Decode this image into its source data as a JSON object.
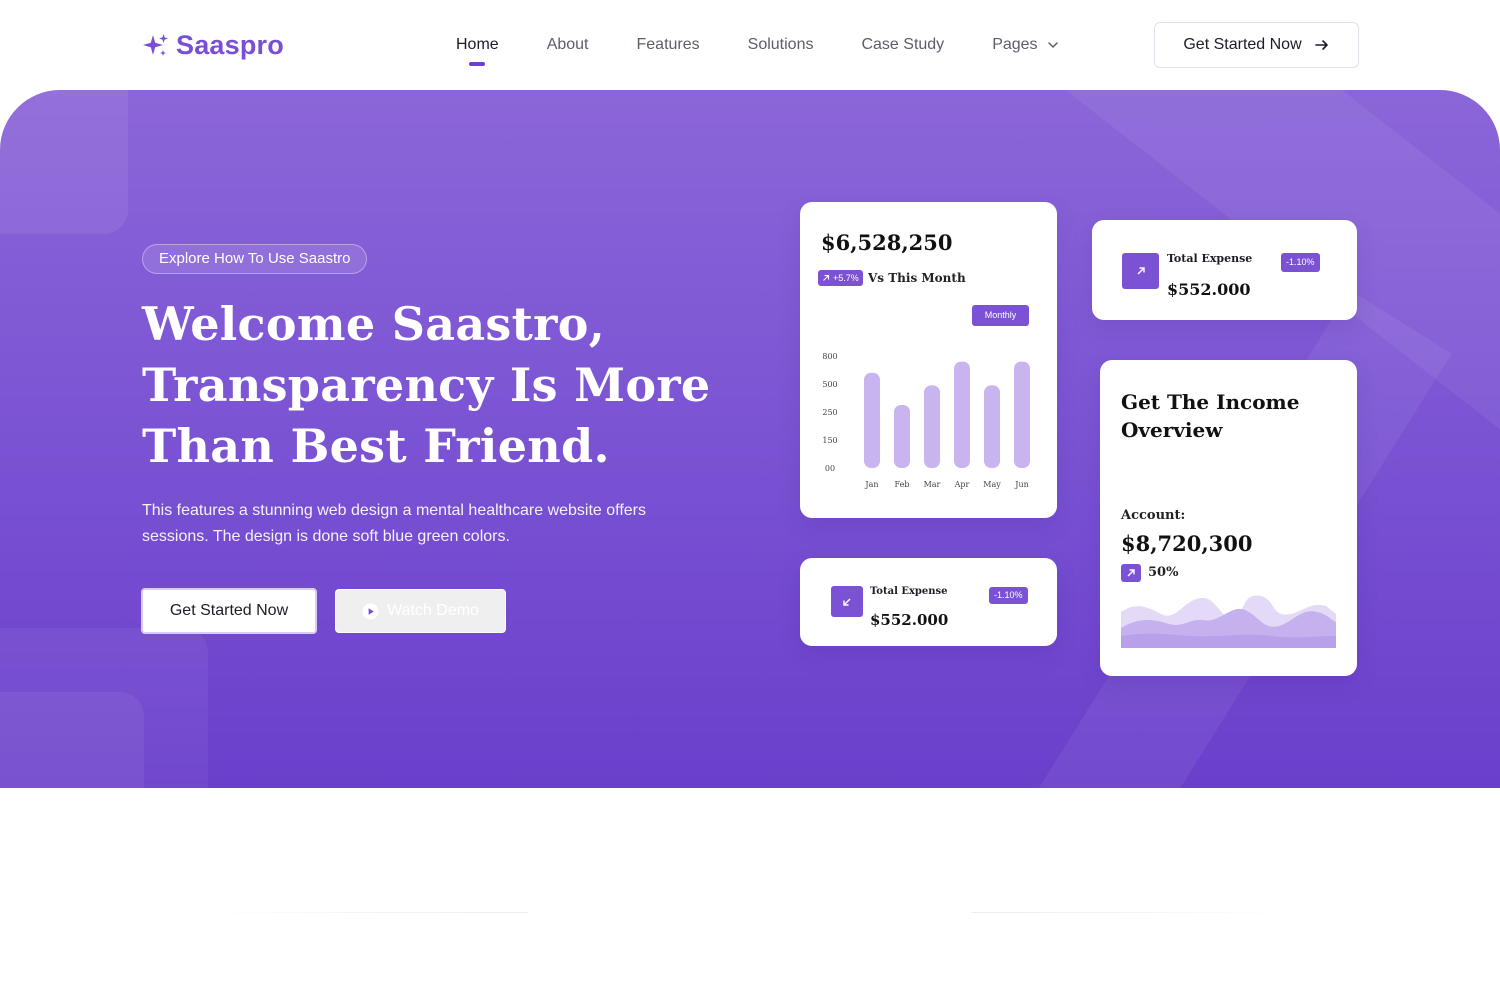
{
  "brand": {
    "name": "Saaspro",
    "color": "#7a4fd6"
  },
  "nav": {
    "items": [
      {
        "label": "Home",
        "active": true
      },
      {
        "label": "About"
      },
      {
        "label": "Features"
      },
      {
        "label": "Solutions"
      },
      {
        "label": "Case Study"
      },
      {
        "label": "Pages",
        "has_dropdown": true
      }
    ],
    "cta_label": "Get Started Now",
    "cta_icon": "arrow-right-icon"
  },
  "hero": {
    "pill": "Explore How To Use Saastro",
    "headline_lines": [
      "Welcome Saastro,",
      "Transparency Is More",
      "Than Best Friend."
    ],
    "subtitle": "This features a stunning web design a mental healthcare website offers sessions. The design is done soft blue green colors.",
    "primary_cta": "Get Started Now",
    "secondary_cta": "Watch Demo",
    "secondary_icon": "play-circle-icon",
    "accent_color": "#7b52d3"
  },
  "revenue_card": {
    "amount": "$6,528,250",
    "delta": "+5.7%",
    "comparison": "Vs This Month",
    "period": "Monthly"
  },
  "expense_card_top": {
    "label": "Total Expense",
    "value": "$552.000",
    "change": "-1.10%",
    "icon": "arrow-up-right-icon"
  },
  "expense_card_bottom": {
    "label": "Total Expense",
    "value": "$552.000",
    "change": "-1.10%",
    "icon": "arrow-down-left-icon"
  },
  "income_card": {
    "title": "Get The Income Overview",
    "account_label": "Account:",
    "account_value": "$8,720,300",
    "percent": "50%",
    "icon": "arrow-up-right-icon"
  },
  "chart_data": {
    "type": "bar",
    "categories": [
      "Jan",
      "Feb",
      "Mar",
      "Apr",
      "May",
      "Jun"
    ],
    "values": [
      680,
      450,
      590,
      760,
      590,
      760
    ],
    "y_tick_labels": [
      "800",
      "500",
      "250",
      "150",
      "00"
    ],
    "y_tick_positions": [
      800,
      600,
      400,
      200,
      0
    ],
    "ylim": [
      0,
      800
    ],
    "bar_color": "#c8b4ef",
    "title": "",
    "xlabel": "",
    "ylabel": ""
  }
}
